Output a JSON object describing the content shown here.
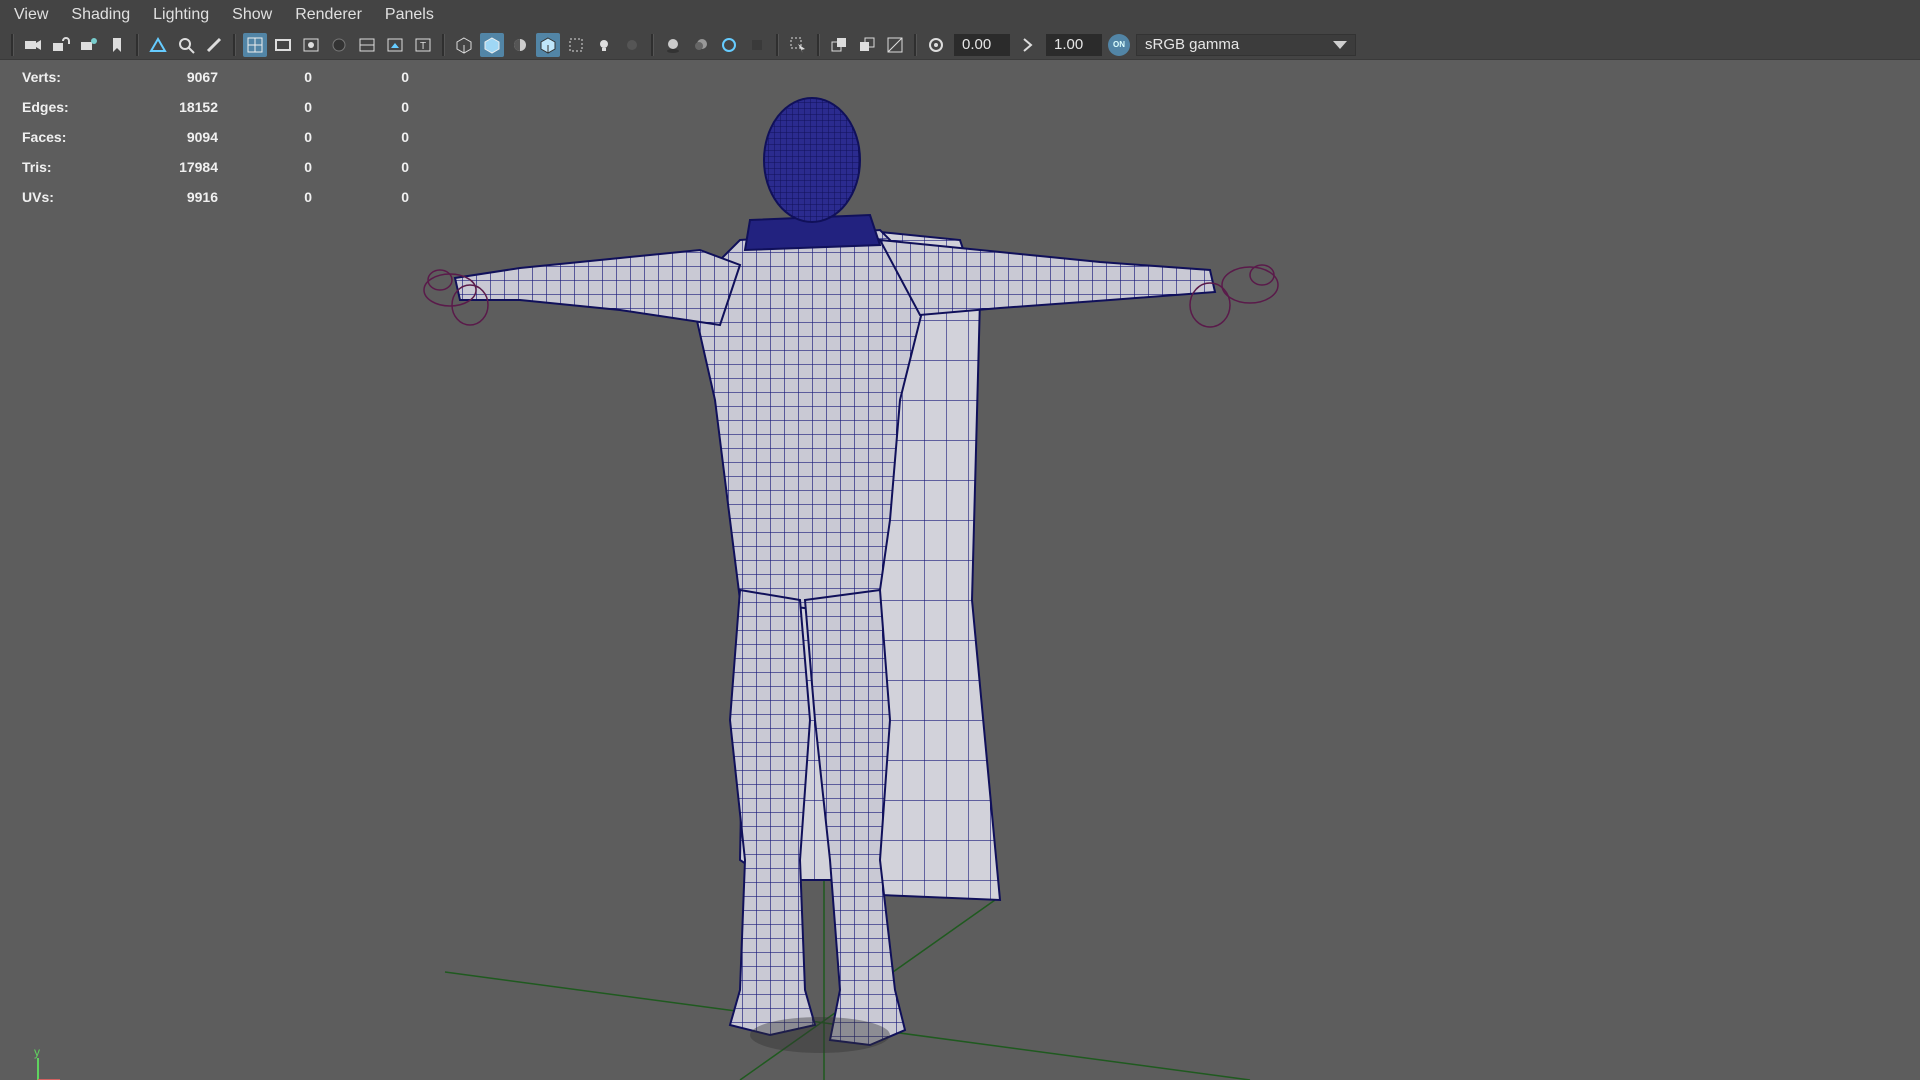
{
  "menubar": {
    "items": [
      "View",
      "Shading",
      "Lighting",
      "Show",
      "Renderer",
      "Panels"
    ]
  },
  "toolbar": {
    "exposure_value": "0.00",
    "gamma_value": "1.00",
    "color_space": "sRGB gamma",
    "icons": [
      "camera-icon",
      "lock-camera-icon",
      "camera-attributes-icon",
      "bookmark-icon",
      "image-plane-icon",
      "2d-pan-zoom-icon",
      "grease-pencil-icon",
      "grid-icon",
      "film-gate-icon",
      "resolution-gate-icon",
      "gate-mask-icon",
      "field-chart-icon",
      "safe-action-icon",
      "safe-title-icon",
      "wireframe-icon",
      "smooth-shade-icon",
      "default-material-icon",
      "wireframe-on-shaded-icon",
      "xray-icon",
      "lights-icon",
      "shadows-icon",
      "ambient-occlusion-icon",
      "motion-blur-icon",
      "anti-aliasing-icon",
      "depth-of-field-icon",
      "isolate-select-icon",
      "xray-joints-icon",
      "xray-active-icon",
      "backface-icon",
      "exposure-icon",
      "gamma-icon",
      "color-management-icon",
      "dropdown-arrow-icon"
    ]
  },
  "hud": {
    "rows": [
      {
        "label": "Verts:",
        "v1": "9067",
        "v2": "0",
        "v3": "0"
      },
      {
        "label": "Edges:",
        "v1": "18152",
        "v2": "0",
        "v3": "0"
      },
      {
        "label": "Faces:",
        "v1": "9094",
        "v2": "0",
        "v3": "0"
      },
      {
        "label": "Tris:",
        "v1": "17984",
        "v2": "0",
        "v3": "0"
      },
      {
        "label": "UVs:",
        "v1": "9916",
        "v2": "0",
        "v3": "0"
      }
    ]
  },
  "axis": {
    "y_label": "y"
  },
  "colors": {
    "background": "#5d5d5d",
    "menubar": "#444444",
    "wireframe": "#1a1a7a",
    "mesh_fill": "#c9c9d4",
    "grid_line": "#1f5a1f",
    "active_button": "#5285a6"
  }
}
